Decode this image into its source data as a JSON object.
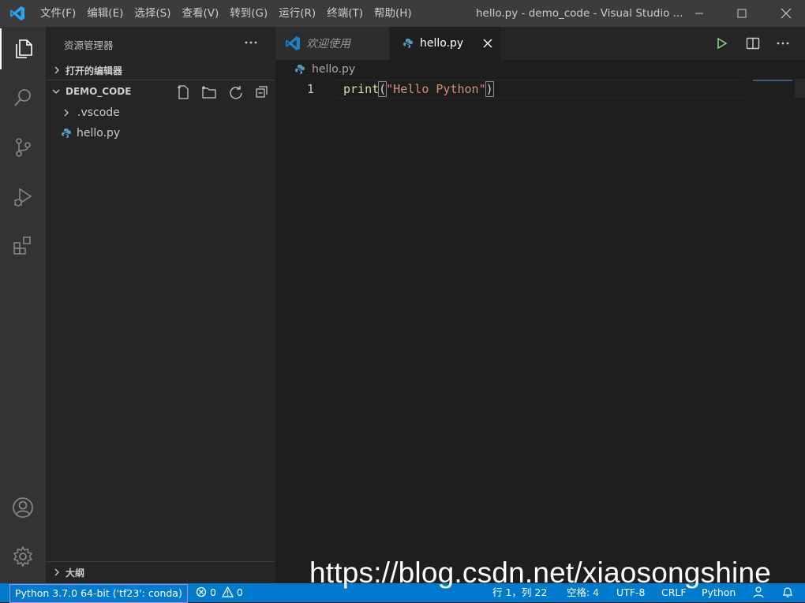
{
  "menu": [
    "文件(F)",
    "编辑(E)",
    "选择(S)",
    "查看(V)",
    "转到(G)",
    "运行(R)",
    "终端(T)",
    "帮助(H)"
  ],
  "window_title": "hello.py - demo_code - Visual Studio ...",
  "sidebar": {
    "title": "资源管理器",
    "open_editors": "打开的编辑器",
    "folder": "DEMO_CODE",
    "items": [
      ".vscode",
      "hello.py"
    ],
    "outline": "大纲"
  },
  "tabs": [
    {
      "label": "欢迎使用"
    },
    {
      "label": "hello.py"
    }
  ],
  "breadcrumb": "hello.py",
  "editor": {
    "line_number": "1",
    "code_fn": "print",
    "code_open": "(",
    "code_str": "\"Hello Python\"",
    "code_close": ")"
  },
  "status": {
    "interpreter": "Python 3.7.0 64-bit ('tf23': conda)",
    "errors": "0",
    "warnings": "0",
    "position": "行 1，列 22",
    "spaces": "空格: 4",
    "encoding": "UTF-8",
    "eol": "CRLF",
    "language": "Python"
  },
  "watermark": "https://blog.csdn.net/xiaosongshine",
  "colors": {
    "accent": "#007acc",
    "keyword": "#dcdcaa",
    "string": "#ce9178",
    "highlight_border": "#c586c0"
  }
}
